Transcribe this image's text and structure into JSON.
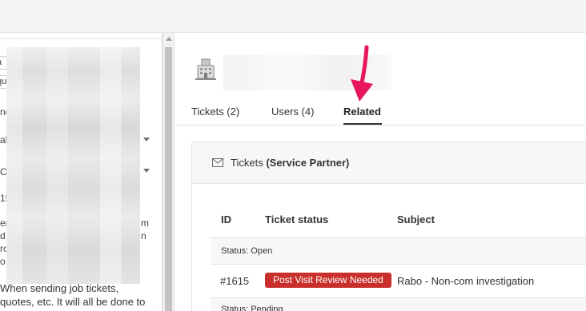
{
  "left_panel": {
    "fragments": [
      "a",
      "qu",
      "nc",
      "al",
      "Ca",
      "15",
      "er",
      "d",
      "ro",
      "o",
      "m",
      "n"
    ],
    "text_line1": "When sending job tickets,",
    "text_line2": "quotes, etc. It will all be done to"
  },
  "org_header": {
    "icon": "building-icon"
  },
  "tabs": [
    {
      "label": "Tickets (2)"
    },
    {
      "label": "Users (4)"
    },
    {
      "label": "Related"
    }
  ],
  "active_tab": "Related",
  "card": {
    "icon": "envelope-icon",
    "title_prefix": "Tickets",
    "title_bold": "(Service Partner)",
    "columns": [
      "ID",
      "Ticket status",
      "Subject"
    ],
    "groups": [
      {
        "label": "Status: Open",
        "rows": [
          {
            "id": "#1615",
            "status": "Post Visit Review Needed",
            "subject": "Rabo - Non-com investigation"
          }
        ]
      },
      {
        "label": "Status: Pending",
        "rows": []
      }
    ]
  },
  "colors": {
    "badge": "#c9302c",
    "arrow": "#e8175d"
  }
}
